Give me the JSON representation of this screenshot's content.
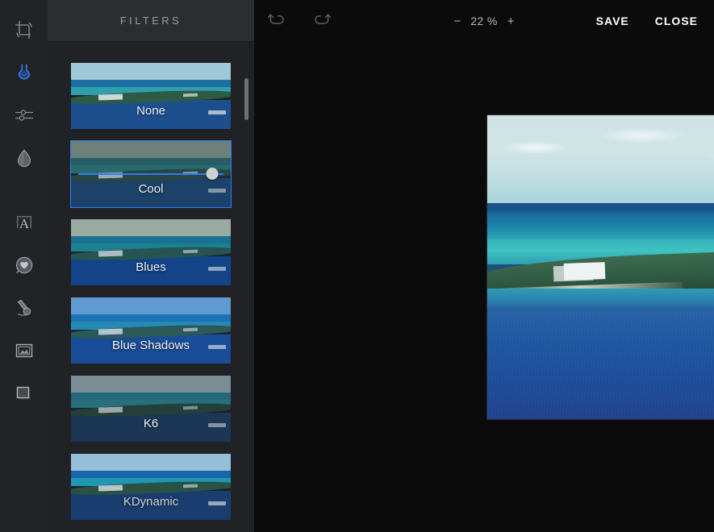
{
  "toolrail": {
    "items": [
      {
        "name": "crop-tool",
        "icon": "crop-icon",
        "active": false
      },
      {
        "name": "filters-tool",
        "icon": "flask-icon",
        "active": true
      },
      {
        "name": "adjust-tool",
        "icon": "sliders-icon",
        "active": false
      },
      {
        "name": "effects-tool",
        "icon": "droplet-icon",
        "active": false
      },
      {
        "name": "text-tool",
        "icon": "text-a-icon",
        "active": false
      },
      {
        "name": "sticker-tool",
        "icon": "sticker-icon",
        "active": false
      },
      {
        "name": "retouch-tool",
        "icon": "brush-icon",
        "active": false
      },
      {
        "name": "frame-tool",
        "icon": "frame-icon",
        "active": false
      },
      {
        "name": "border-tool",
        "icon": "square-icon",
        "active": false
      }
    ]
  },
  "panel": {
    "title": "FILTERS",
    "filters": [
      {
        "label": "None",
        "selected": false,
        "sky": "#9fc9d8",
        "farsea": "#1c6f9e",
        "shallow": "#2f9fae",
        "land": "#2c5a44",
        "sea": "#1d4f8f",
        "tint": "rgba(0,0,0,0)"
      },
      {
        "label": "Cool",
        "selected": true,
        "sky": "#8d9a86",
        "farsea": "#2c6b6a",
        "shallow": "#2b7d78",
        "land": "#2b4a3c",
        "sea": "#1d4470",
        "tint": "rgba(30,60,90,0.28)",
        "slider": {
          "value": 92
        }
      },
      {
        "label": "Blues",
        "selected": false,
        "sky": "#b9c3a8",
        "farsea": "#1a7d94",
        "shallow": "#1f8f93",
        "land": "#2d5a48",
        "sea": "#15458a",
        "tint": "rgba(10,60,130,0.18)"
      },
      {
        "label": "Blue Shadows",
        "selected": false,
        "sky": "#6ea8d8",
        "farsea": "#1f79b8",
        "shallow": "#2897b8",
        "land": "#2f5c4c",
        "sea": "#1b4f96",
        "tint": "rgba(20,70,160,0.14)"
      },
      {
        "label": "K6",
        "selected": false,
        "sky": "#9fb4b8",
        "farsea": "#2d7f95",
        "shallow": "#2f8c94",
        "land": "#2a4b3c",
        "sea": "#1f3f63",
        "tint": "rgba(20,30,50,0.26)"
      },
      {
        "label": "KDynamic",
        "selected": false,
        "sky": "#a8d2ea",
        "farsea": "#1b6fb5",
        "shallow": "#22a6c0",
        "land": "#2e5a46",
        "sea": "#1d4277",
        "tint": "rgba(0,20,60,0.10)",
        "clipped": true
      }
    ],
    "scrollbar": {
      "thumb_top_pct": 4,
      "thumb_height_pct": 9
    }
  },
  "topbar": {
    "undo_icon": "undo-icon",
    "redo_icon": "redo-icon",
    "zoom_out_label": "−",
    "zoom_value": "22 %",
    "zoom_in_label": "+",
    "save_label": "SAVE",
    "close_label": "CLOSE"
  },
  "canvas": {
    "name": "image-canvas",
    "description": "tropical coastline photo"
  },
  "colors": {
    "accent": "#2d7df6",
    "rail_bg": "#222326",
    "panel_bg": "#212225",
    "panel_header_bg": "#2b2d30",
    "main_bg": "#0b0b0c",
    "title_text": "#9a9ca0",
    "action_text": "#ffffff"
  }
}
